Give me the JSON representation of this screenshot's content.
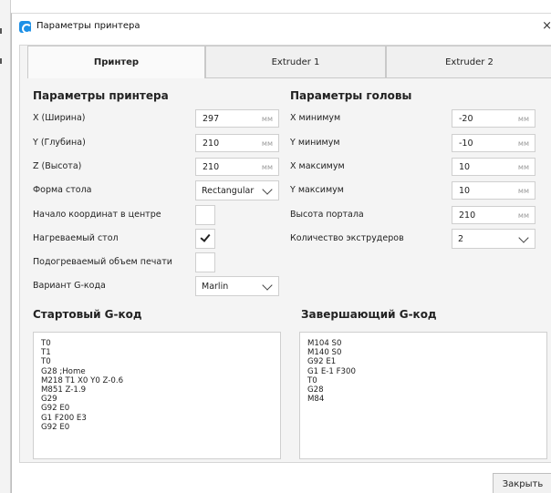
{
  "window": {
    "title": "Параметры принтера",
    "close": "×"
  },
  "tabs": [
    "Принтер",
    "Extruder 1",
    "Extruder 2"
  ],
  "printer": {
    "title": "Параметры принтера",
    "x_label": "X (Ширина)",
    "x_value": "297",
    "x_unit": "мм",
    "y_label": "Y (Глубина)",
    "y_value": "210",
    "y_unit": "мм",
    "z_label": "Z (Высота)",
    "z_value": "210",
    "z_unit": "мм",
    "bed_shape_label": "Форма стола",
    "bed_shape_value": "Rectangular",
    "origin_center_label": "Начало координат в центре",
    "heated_bed_label": "Нагреваемый стол",
    "heated_volume_label": "Подогреваемый объем печати",
    "gcode_flavor_label": "Вариант G-кода",
    "gcode_flavor_value": "Marlin"
  },
  "head": {
    "title": "Параметры головы",
    "xmin_label": "X минимум",
    "xmin_value": "-20",
    "xmin_unit": "мм",
    "ymin_label": "Y минимум",
    "ymin_value": "-10",
    "ymin_unit": "мм",
    "xmax_label": "X максимум",
    "xmax_value": "10",
    "xmax_unit": "мм",
    "ymax_label": "Y максимум",
    "ymax_value": "10",
    "ymax_unit": "мм",
    "gantry_label": "Высота портала",
    "gantry_value": "210",
    "gantry_unit": "мм",
    "extruders_label": "Количество экструдеров",
    "extruders_value": "2"
  },
  "start_gcode": {
    "title": "Стартовый G-код",
    "lines": [
      "T0",
      "T1",
      "T0",
      "G28 ;Home",
      "M218 T1 X0 Y0 Z-0.6",
      "M851 Z-1.9",
      "G29",
      "G92 E0",
      "G1 F200 E3",
      "G92 E0"
    ]
  },
  "end_gcode": {
    "title": "Завершающий G-код",
    "lines": [
      "M104 S0",
      "M140 S0",
      "G92 E1",
      "G1 E-1 F300",
      "T0",
      "G28",
      "M84"
    ]
  },
  "footer": {
    "close_button": "Закрыть"
  }
}
